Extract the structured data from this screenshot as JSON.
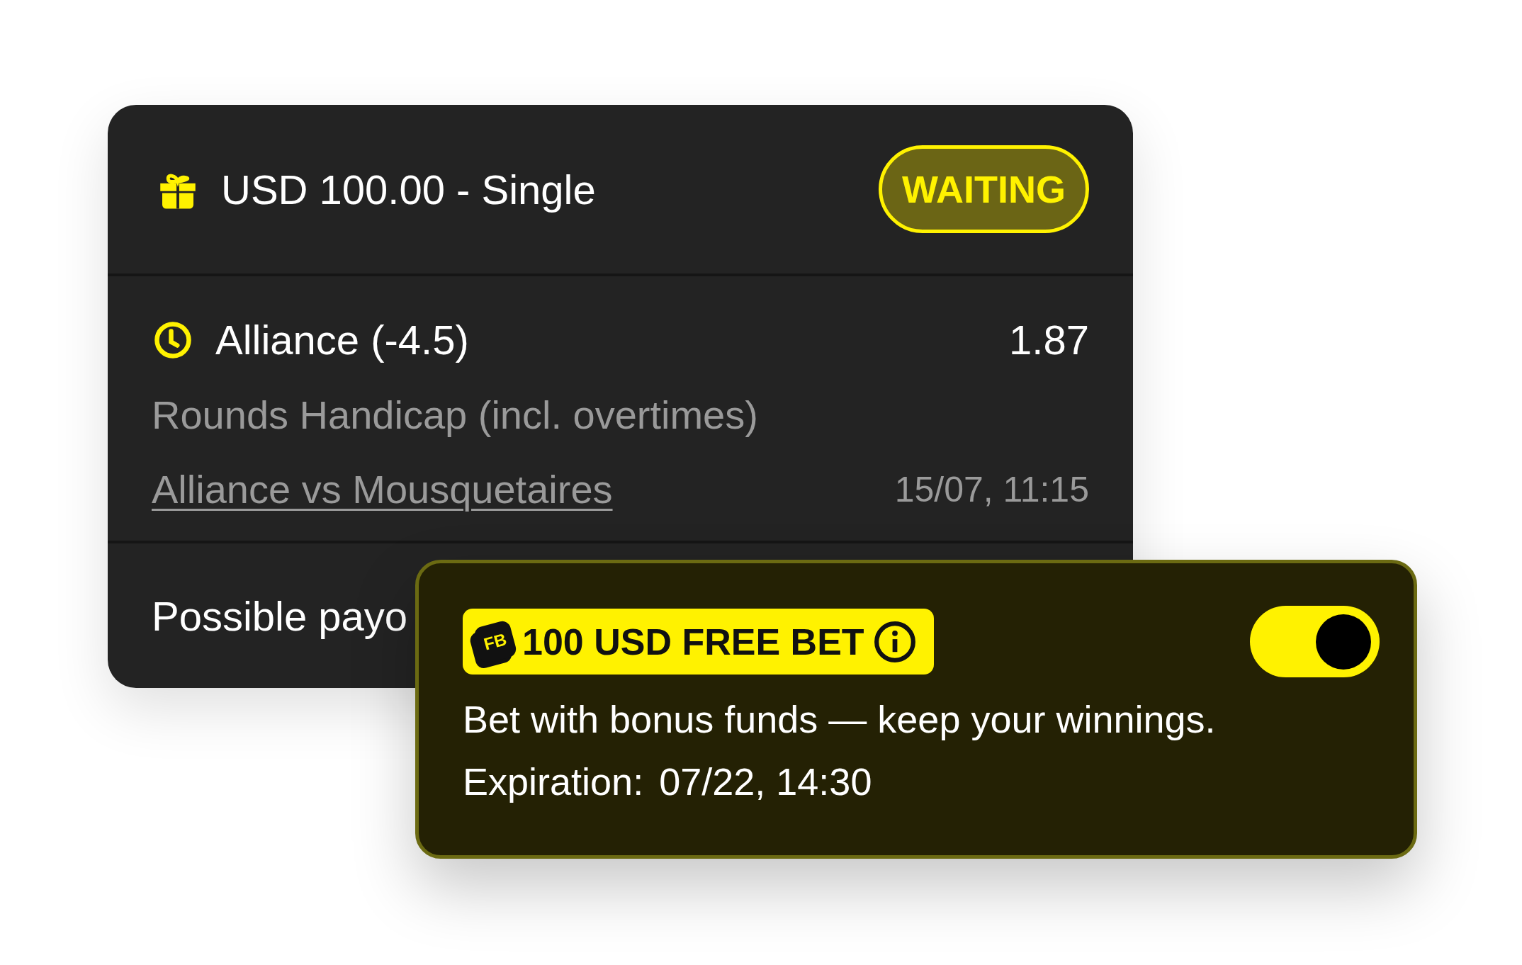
{
  "bet": {
    "title": "USD 100.00 - Single",
    "status": "WAITING",
    "selection": {
      "name": "Alliance (-4.5)",
      "odds": "1.87",
      "market": "Rounds Handicap (incl. overtimes)",
      "event": "Alliance vs Mousquetaires",
      "datetime": "15/07, 11:15"
    },
    "payout_label": "Possible payo"
  },
  "free_bet": {
    "logo": "FB",
    "title": "100 USD FREE BET",
    "on": true,
    "description": "Bet with bonus funds — keep your winnings.",
    "expiration_label": "Expiration:",
    "expiration_value": "07/22, 14:30"
  }
}
